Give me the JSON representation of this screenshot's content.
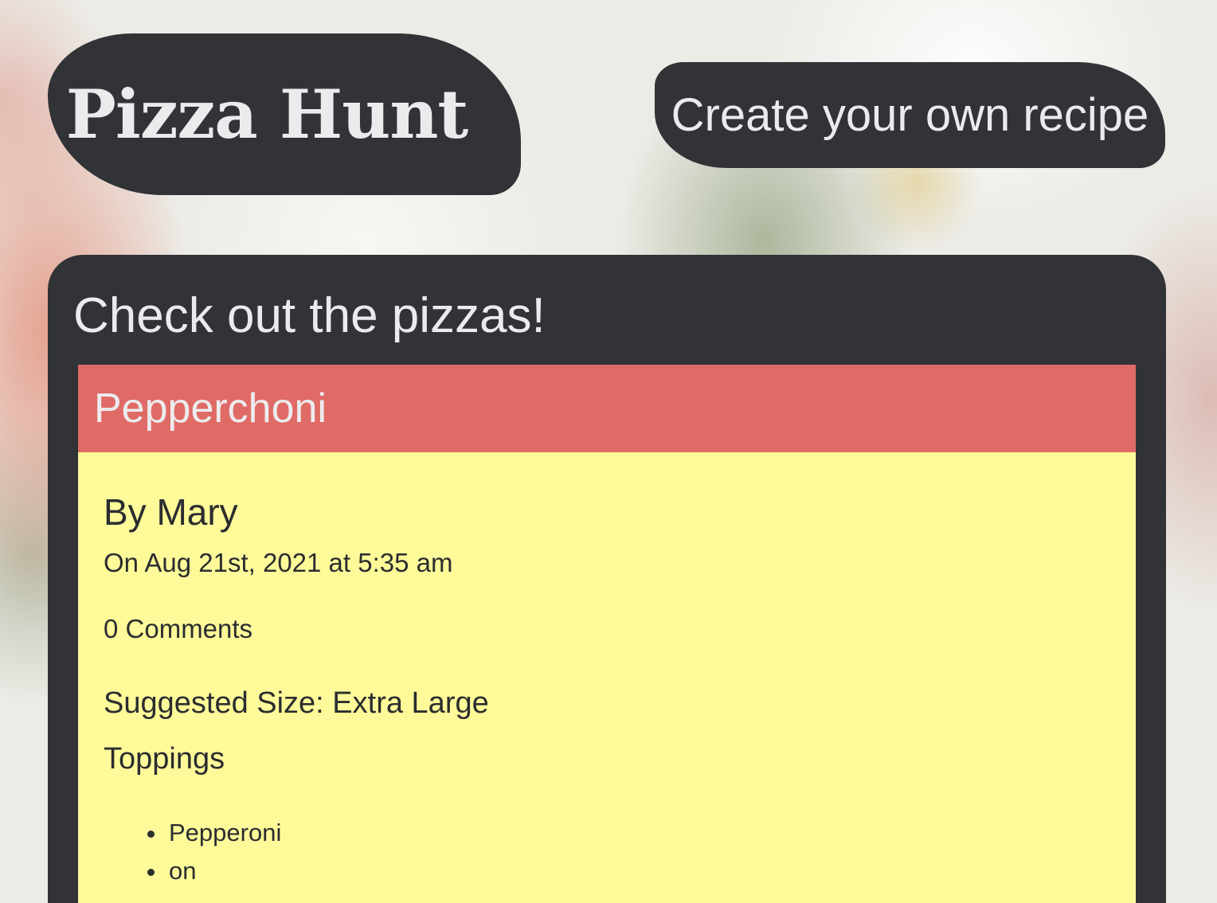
{
  "header": {
    "brand_title": "Pizza Hunt",
    "create_button_label": "Create your own recipe"
  },
  "main": {
    "heading": "Check out the pizzas!",
    "pizzas": [
      {
        "name": "Pepperchoni",
        "author_line": "By Mary",
        "date_line": "On Aug 21st, 2021 at 5:35 am",
        "comments_label": "0 Comments",
        "size_line": "Suggested Size: Extra Large",
        "toppings_heading": "Toppings",
        "toppings": [
          "Pepperoni",
          "on"
        ]
      }
    ]
  },
  "colors": {
    "dark_panel": "#313336",
    "card_header": "#e06b66",
    "card_body": "#fefa99",
    "light_text": "#ebebee"
  }
}
